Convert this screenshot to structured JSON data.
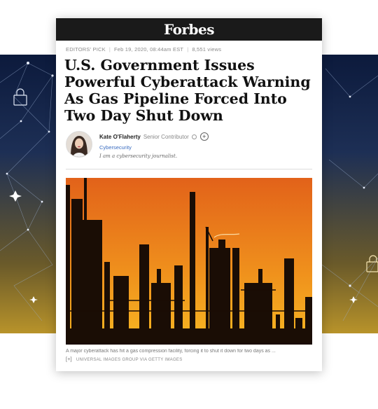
{
  "site": {
    "logo": "Forbes"
  },
  "meta": {
    "tag": "EDITORS' PICK",
    "date": "Feb 19, 2020, 08:44am EST",
    "views": "8,551 views"
  },
  "article": {
    "headline": "U.S. Government Issues Powerful Cyberattack Warning As Gas Pipeline Forced Into Two Day Shut Down"
  },
  "author": {
    "name": "Kate O'Flaherty",
    "role": "Senior Contributor",
    "follow_symbol": "+",
    "topic": "Cybersecurity",
    "bio": "I am a cybersecurity journalist."
  },
  "image": {
    "caption": "A major cyberattack has hit a gas compression facility, forcing it to shut it down for two days as ...",
    "expand_label": "[+]",
    "credit": "UNIVERSAL IMAGES GROUP VIA GETTY IMAGES"
  },
  "colors": {
    "masthead": "#1a1a1a",
    "link": "#3a6cc0",
    "sky_top": "#e0661a",
    "sky_bottom": "#f5b21c"
  },
  "icons": [
    "lock-icon",
    "network-graph-icon",
    "follow-plus-icon",
    "info-icon"
  ]
}
